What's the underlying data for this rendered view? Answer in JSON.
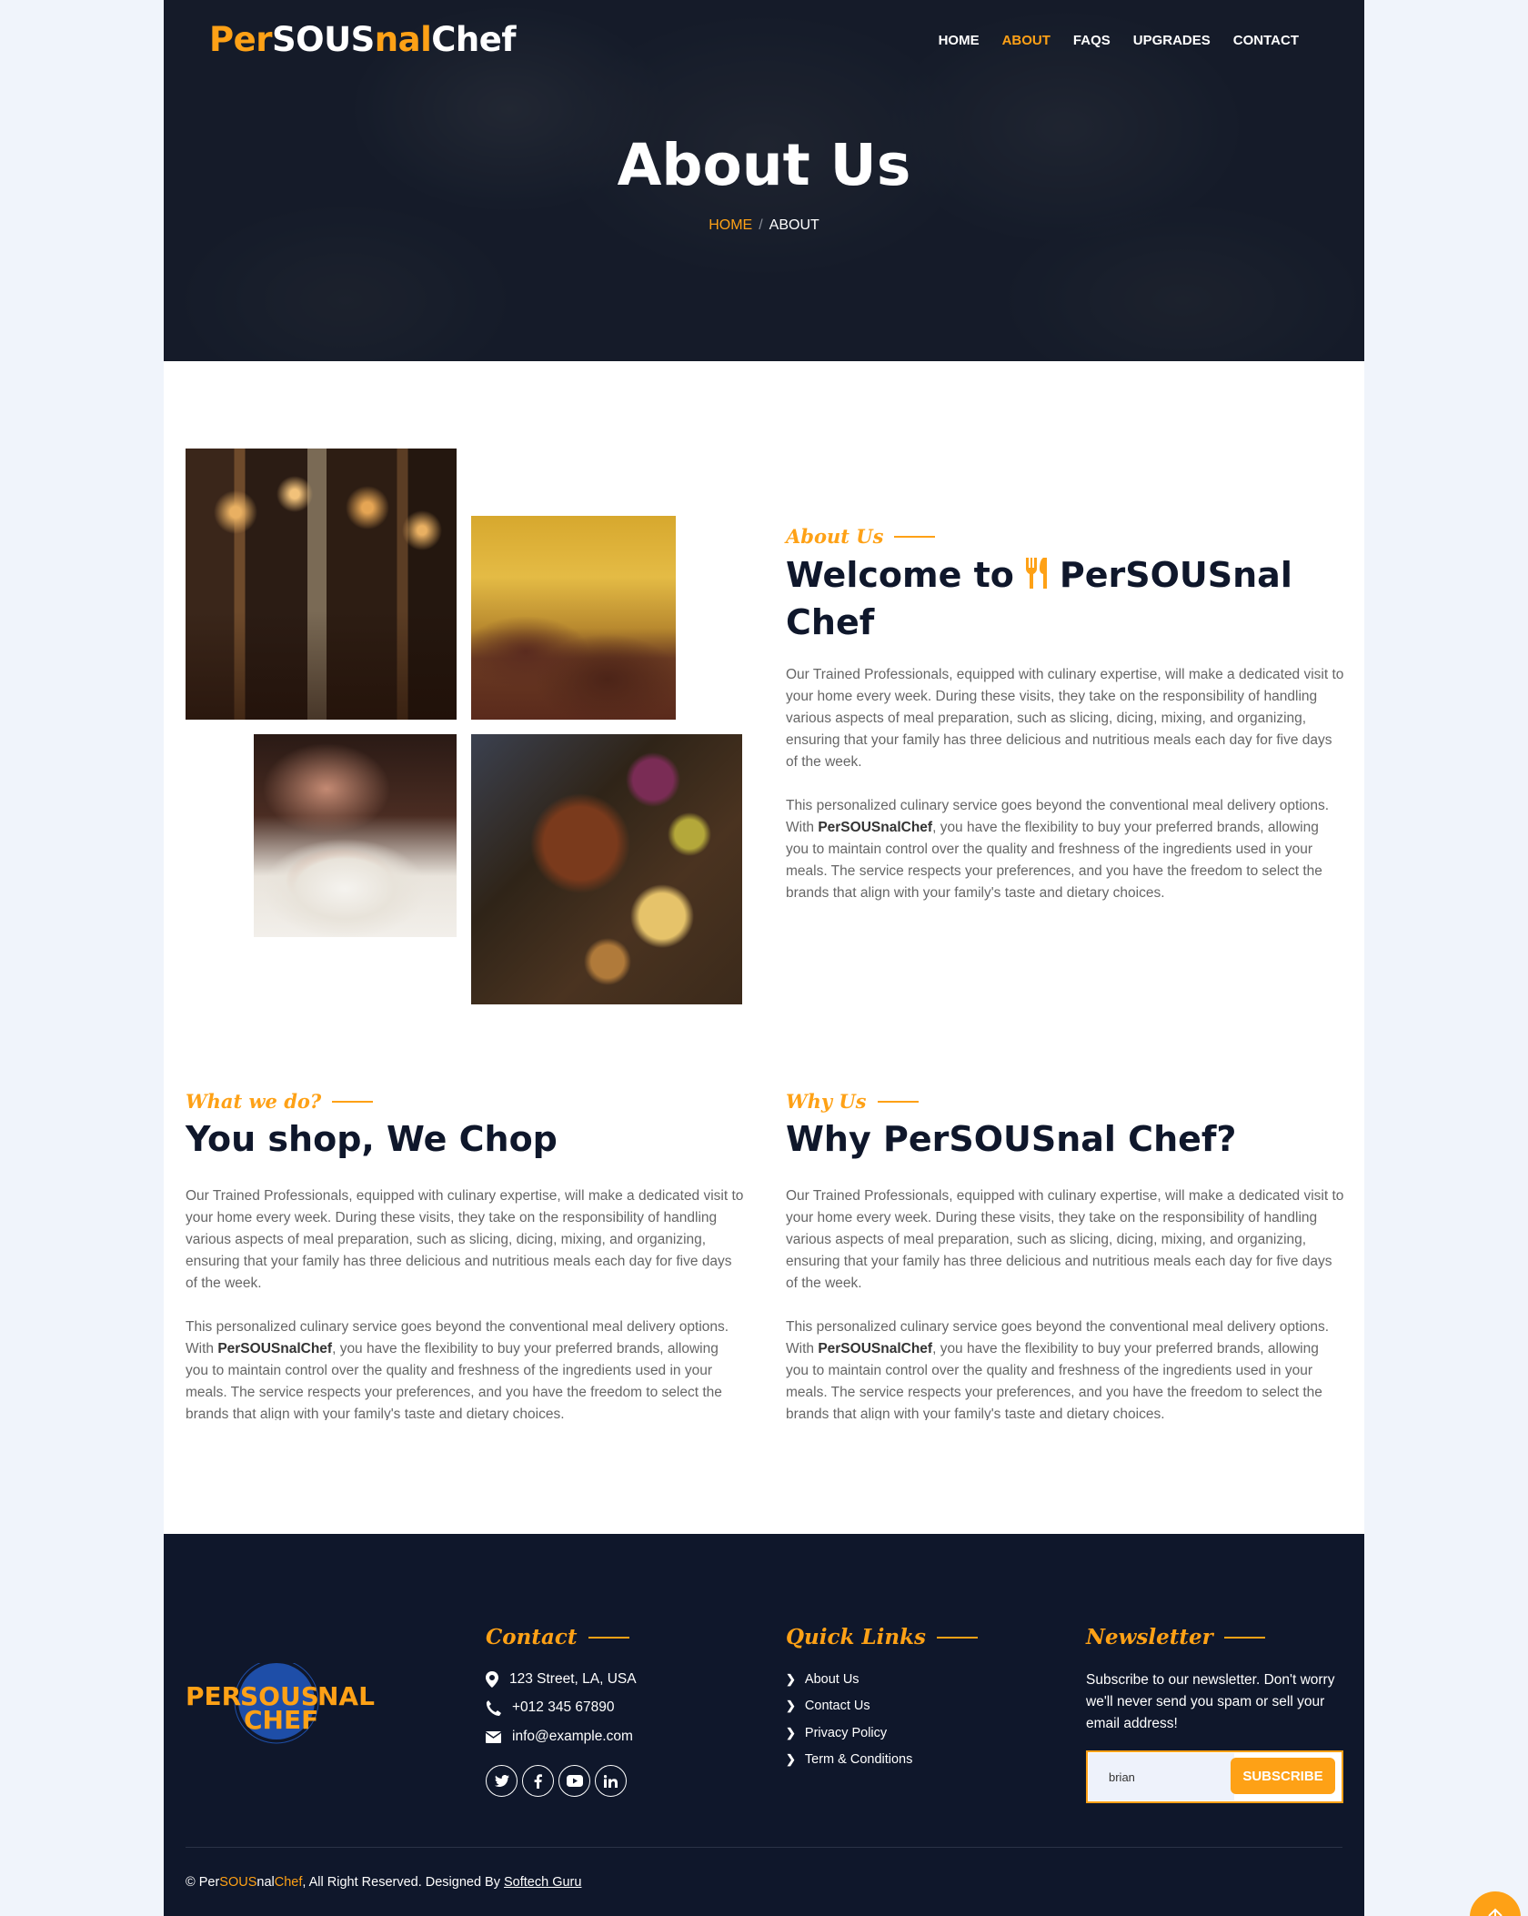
{
  "brand": {
    "part1": "Per",
    "part2": "SOUS",
    "part3": "nal",
    "part4": "Chef"
  },
  "nav": [
    {
      "label": "HOME",
      "active": false
    },
    {
      "label": "ABOUT",
      "active": true
    },
    {
      "label": "FAQS",
      "active": false
    },
    {
      "label": "UPGRADES",
      "active": false
    },
    {
      "label": "CONTACT",
      "active": false
    }
  ],
  "hero": {
    "title": "About Us",
    "crumb_home": "HOME",
    "crumb_sep": "/",
    "crumb_current": "ABOUT"
  },
  "about": {
    "eyebrow": "About Us",
    "heading_line1": "Welcome to",
    "heading_brand": "PerSOUSnal",
    "heading_line2": "Chef",
    "para1": "Our Trained Professionals, equipped with culinary expertise, will make a dedicated visit to your home every week. During these visits, they take on the responsibility of handling various aspects of meal preparation, such as slicing, dicing, mixing, and organizing, ensuring that your family has three delicious and nutritious meals each day for five days of the week.",
    "para2_pre": "This personalized culinary service goes beyond the conventional meal delivery options. With ",
    "para2_brand": "PerSOUSnalChef",
    "para2_post": ", you have the flexibility to buy your preferred brands, allowing you to maintain control over the quality and freshness of the ingredients used in your meals. The service respects your preferences, and you have the freedom to select the brands that align with your family's taste and dietary choices."
  },
  "what": {
    "eyebrow": "What we do?",
    "heading": "You shop, We Chop"
  },
  "why": {
    "eyebrow": "Why Us",
    "heading": "Why PerSOUSnal Chef?"
  },
  "footer": {
    "logo": {
      "top_left": "PER",
      "top_mid": "SOUS",
      "top_right": "NAL",
      "bottom": "CHEF"
    },
    "contact_title": "Contact",
    "address": "123 Street, LA, USA",
    "phone": "+012 345 67890",
    "email": "info@example.com",
    "social_icons": [
      "twitter-icon",
      "facebook-icon",
      "youtube-icon",
      "linkedin-icon"
    ],
    "links_title": "Quick Links",
    "links": [
      "About Us",
      "Contact Us",
      "Privacy Policy",
      "Term & Conditions"
    ],
    "news_title": "Newsletter",
    "news_text": "Subscribe to our newsletter. Don't worry we'll never send you spam or sell your email address!",
    "news_value": "brian",
    "news_button": "SUBSCRIBE",
    "copy_prefix": "© Per",
    "copy_sous": "SOUS",
    "copy_nal": "nal",
    "copy_chef": "Chef",
    "copy_suffix": ", All Right Reserved. Designed By ",
    "copy_designer": "Softech Guru"
  },
  "colors": {
    "accent": "#fea116",
    "dark": "#0f172b"
  }
}
